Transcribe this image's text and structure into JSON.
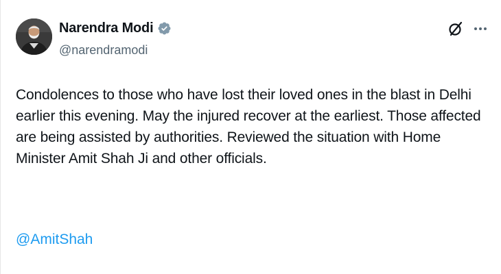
{
  "tweet": {
    "author": {
      "display_name": "Narendra Modi",
      "handle": "@narendramodi",
      "verified": true
    },
    "body": "Condolences to those who have lost their loved ones in the blast in Delhi earlier this evening. May the injured recover at the earliest. Those affected are being assisted by authorities. Reviewed the situation with Home Minister Amit Shah Ji and other officials.",
    "mention": "@AmitShah"
  },
  "icons": {
    "verified": "verified-badge-icon",
    "grok": "grok-icon",
    "more": "more-options-icon"
  },
  "colors": {
    "text": "#0f1419",
    "secondary": "#536471",
    "link": "#1d9bf0",
    "verified_badge": "#829aab"
  }
}
